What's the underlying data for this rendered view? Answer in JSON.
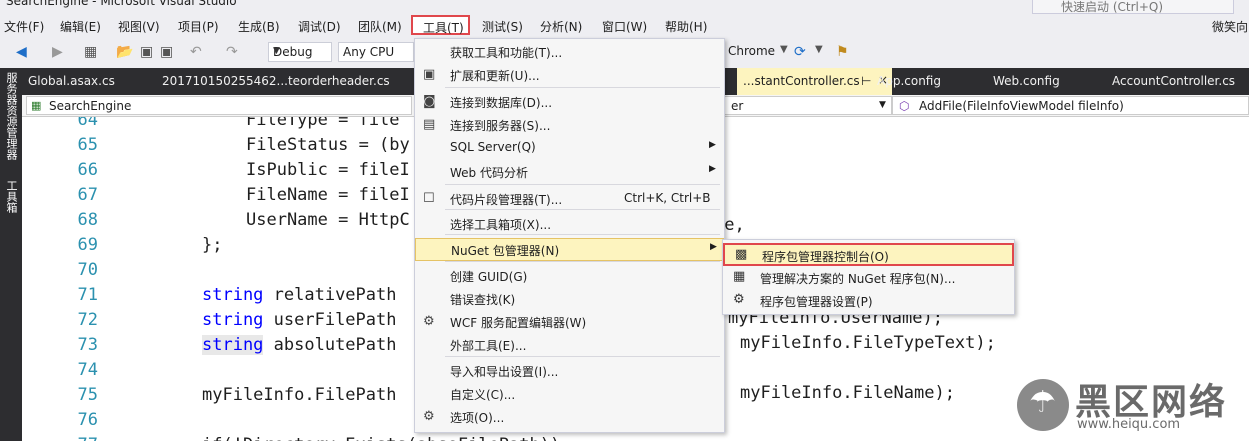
{
  "window": {
    "title": "SearchEngine - Microsoft Visual Studio",
    "quick_launch_placeholder": "快速启动 (Ctrl+Q)",
    "user": "微笑向"
  },
  "menubar": {
    "items": [
      "文件(F)",
      "编辑(E)",
      "视图(V)",
      "项目(P)",
      "生成(B)",
      "调试(D)",
      "团队(M)",
      "工具(T)",
      "测试(S)",
      "分析(N)",
      "窗口(W)",
      "帮助(H)"
    ]
  },
  "toolbar": {
    "configuration": "Debug",
    "platform": "Any CPU",
    "browser": "Chrome"
  },
  "side_panel": {
    "server_explorer": "服务器资源管理器",
    "toolbox": "工具箱"
  },
  "tabs": {
    "items": [
      "Global.asax.cs",
      "201710150255462...teorderheader.cs",
      "App.config",
      "Web.config",
      "AccountController.cs"
    ],
    "active": "...stantController.cs"
  },
  "navbar": {
    "project": "SearchEngine",
    "type_fragment": "er",
    "member": "AddFile(FileInfoViewModel fileInfo)"
  },
  "editor": {
    "lines": [
      {
        "n": "64",
        "t": "FileType = file"
      },
      {
        "n": "65",
        "t": "FileStatus = (by"
      },
      {
        "n": "66",
        "t": "IsPublic = fileI"
      },
      {
        "n": "67",
        "t": "FileName = fileI"
      },
      {
        "n": "68",
        "t": "UserName = HttpC"
      },
      {
        "n": "69",
        "t": "};"
      },
      {
        "n": "70",
        "t": ""
      },
      {
        "n": "71",
        "kw": "string",
        "t": " relativePath"
      },
      {
        "n": "72",
        "kw": "string",
        "t": " userFilePath"
      },
      {
        "n": "73",
        "kw": "string",
        "t": " absolutePath"
      },
      {
        "n": "74",
        "t": ""
      },
      {
        "n": "75",
        "t": "myFileInfo.FilePath"
      },
      {
        "n": "76",
        "t": ""
      },
      {
        "n": "77",
        "t": "if(!Directory.Exists(absoFilePath))"
      }
    ],
    "right_fragments": {
      "line68": "me,",
      "line72": "myFileInfo.UserName);",
      "line73": "myFileInfo.FileTypeText);",
      "line75": "myFileInfo.FileName);"
    }
  },
  "tools_menu": {
    "items": [
      {
        "label": "获取工具和功能(T)...",
        "icon": ""
      },
      {
        "label": "扩展和更新(U)...",
        "icon": "extensions-icon"
      },
      {
        "label": "连接到数据库(D)...",
        "icon": "database-icon"
      },
      {
        "label": "连接到服务器(S)...",
        "icon": "server-icon"
      },
      {
        "label": "SQL Server(Q)",
        "submenu": true
      },
      {
        "label": "Web 代码分析",
        "submenu": true
      },
      {
        "label": "代码片段管理器(T)...",
        "shortcut": "Ctrl+K, Ctrl+B",
        "icon": "snippet-icon"
      },
      {
        "label": "选择工具箱项(X)..."
      },
      {
        "label": "NuGet 包管理器(N)",
        "submenu": true
      },
      {
        "label": "创建 GUID(G)"
      },
      {
        "label": "错误查找(K)"
      },
      {
        "label": "WCF 服务配置编辑器(W)",
        "icon": "wcf-icon"
      },
      {
        "label": "外部工具(E)..."
      },
      {
        "label": "导入和导出设置(I)..."
      },
      {
        "label": "自定义(C)..."
      },
      {
        "label": "选项(O)...",
        "icon": "gear-icon"
      }
    ]
  },
  "nuget_submenu": {
    "items": [
      {
        "label": "程序包管理器控制台(O)",
        "icon": "console-icon"
      },
      {
        "label": "管理解决方案的 NuGet 程序包(N)...",
        "icon": "package-icon"
      },
      {
        "label": "程序包管理器设置(P)",
        "icon": "gear-icon"
      }
    ]
  },
  "watermark": {
    "brand": "黑区网络",
    "url": "www.heiqu.com"
  }
}
